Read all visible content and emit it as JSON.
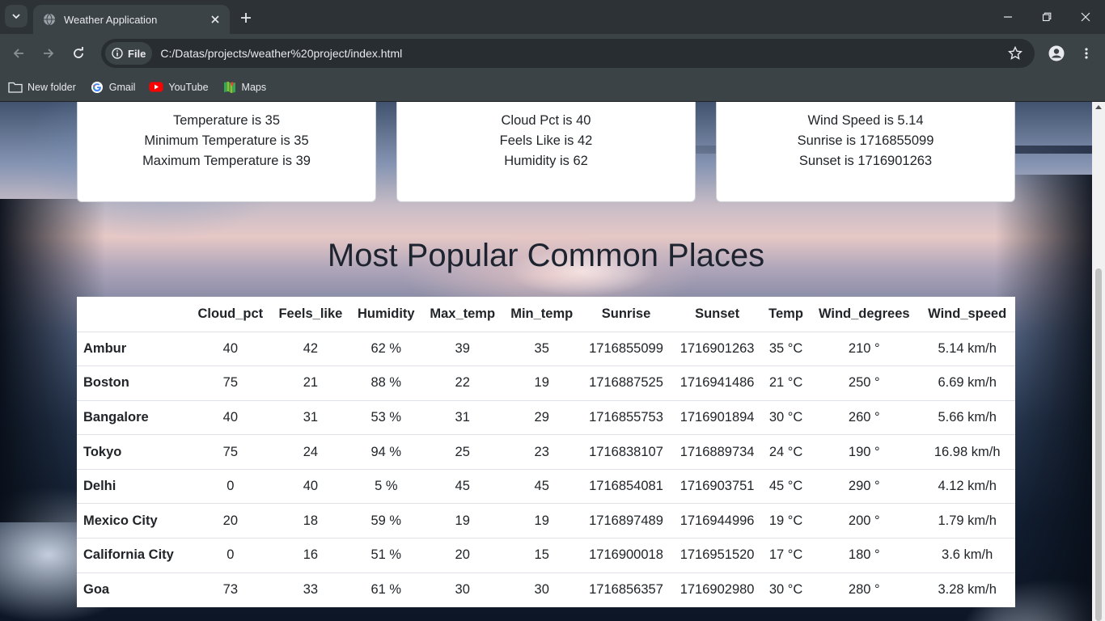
{
  "browser": {
    "tab_title": "Weather Application",
    "site_chip_label": "File",
    "url": "C:/Datas/projects/weather%20project/index.html",
    "bookmarks": [
      {
        "label": "New folder",
        "icon": "folder-icon"
      },
      {
        "label": "Gmail",
        "icon": "google-icon"
      },
      {
        "label": "YouTube",
        "icon": "youtube-icon"
      },
      {
        "label": "Maps",
        "icon": "maps-icon"
      }
    ]
  },
  "cards": [
    {
      "lines": [
        "Temperature is 35",
        "Minimum Temperature is 35",
        "Maximum Temperature is 39"
      ]
    },
    {
      "lines": [
        "Cloud Pct is 40",
        "Feels Like is 42",
        "Humidity is 62"
      ]
    },
    {
      "lines": [
        "Wind Speed is 5.14",
        "Sunrise is 1716855099",
        "Sunset is 1716901263"
      ]
    }
  ],
  "section_title": "Most Popular Common Places",
  "table": {
    "headers": [
      "",
      "Cloud_pct",
      "Feels_like",
      "Humidity",
      "Max_temp",
      "Min_temp",
      "Sunrise",
      "Sunset",
      "Temp",
      "Wind_degrees",
      "Wind_speed"
    ],
    "rows": [
      [
        "Ambur",
        "40",
        "42",
        "62 %",
        "39",
        "35",
        "1716855099",
        "1716901263",
        "35 °C",
        "210 °",
        "5.14 km/h"
      ],
      [
        "Boston",
        "75",
        "21",
        "88 %",
        "22",
        "19",
        "1716887525",
        "1716941486",
        "21 °C",
        "250 °",
        "6.69 km/h"
      ],
      [
        "Bangalore",
        "40",
        "31",
        "53 %",
        "31",
        "29",
        "1716855753",
        "1716901894",
        "30 °C",
        "260 °",
        "5.66 km/h"
      ],
      [
        "Tokyo",
        "75",
        "24",
        "94 %",
        "25",
        "23",
        "1716838107",
        "1716889734",
        "24 °C",
        "190 °",
        "16.98 km/h"
      ],
      [
        "Delhi",
        "0",
        "40",
        "5 %",
        "45",
        "45",
        "1716854081",
        "1716903751",
        "45 °C",
        "290 °",
        "4.12 km/h"
      ],
      [
        "Mexico City",
        "20",
        "18",
        "59 %",
        "19",
        "19",
        "1716897489",
        "1716944996",
        "19 °C",
        "200 °",
        "1.79 km/h"
      ],
      [
        "California City",
        "0",
        "16",
        "51 %",
        "20",
        "15",
        "1716900018",
        "1716951520",
        "17 °C",
        "180 °",
        "3.6 km/h"
      ],
      [
        "Goa",
        "73",
        "33",
        "61 %",
        "30",
        "30",
        "1716856357",
        "1716902980",
        "30 °C",
        "280 °",
        "3.28 km/h"
      ]
    ]
  }
}
